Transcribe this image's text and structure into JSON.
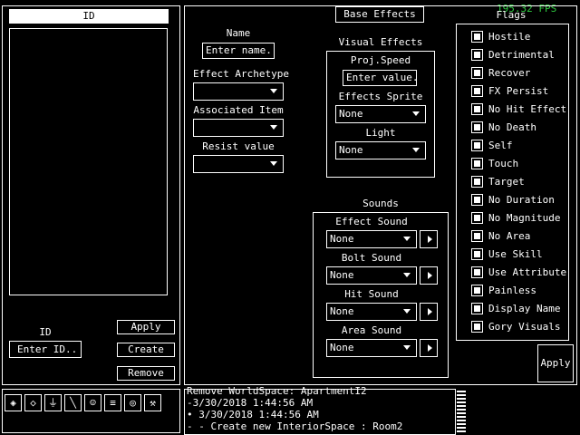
{
  "fps": "195.32 FPS",
  "left_panel": {
    "header": "ID",
    "id_label": "ID",
    "id_placeholder": "Enter ID..",
    "apply": "Apply",
    "create": "Create",
    "remove": "Remove"
  },
  "editor": {
    "tab": "Base Effects",
    "name_label": "Name",
    "name_placeholder": "Enter name..",
    "archetype_label": "Effect Archetype",
    "archetype_value": "",
    "assoc_label": "Associated Item",
    "assoc_value": "",
    "resist_label": "Resist value",
    "resist_value": "",
    "visual_title": "Visual Effects",
    "proj_speed_label": "Proj.Speed",
    "proj_speed_placeholder": "Enter value..",
    "sprite_label": "Effects Sprite",
    "sprite_value": "None",
    "light_label": "Light",
    "light_value": "None",
    "sounds_title": "Sounds",
    "effect_sound_label": "Effect Sound",
    "effect_sound_value": "None",
    "bolt_sound_label": "Bolt Sound",
    "bolt_sound_value": "None",
    "hit_sound_label": "Hit Sound",
    "hit_sound_value": "None",
    "area_sound_label": "Area Sound",
    "area_sound_value": "None",
    "flags_title": "Flags",
    "flags": [
      "Hostile",
      "Detrimental",
      "Recover",
      "FX Persist",
      "No Hit Effect",
      "No Death",
      "Self",
      "Touch",
      "Target",
      "No Duration",
      "No Magnitude",
      "No Area",
      "Use Skill",
      "Use Attribute",
      "Painless",
      "Display Name",
      "Gory Visuals"
    ],
    "apply": "Apply"
  },
  "toolbar_icons": [
    "cube-icon",
    "plane-icon",
    "plug-icon",
    "brush-icon",
    "people-icon",
    "layers-icon",
    "globe-icon",
    "wrench-icon"
  ],
  "log": [
    "Remove WorldSpace: ApartmentI2",
    "-3/30/2018 1:44:56 AM",
    "• 3/30/2018 1:44:56 AM",
    "- - Create new InteriorSpace : Room2"
  ]
}
